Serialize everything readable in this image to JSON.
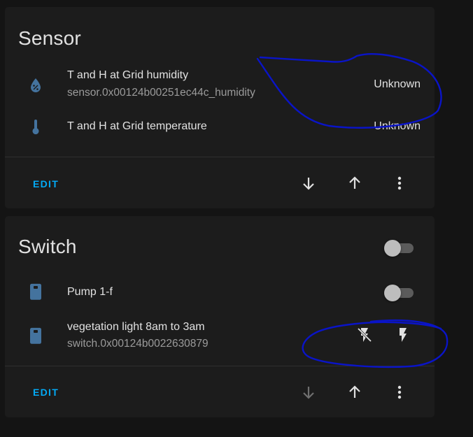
{
  "colors": {
    "background": "#141414",
    "card": "#1c1c1c",
    "accent": "#03a9f4",
    "icon": "#44739e",
    "annotation": "#0a14c8"
  },
  "sensor_card": {
    "title": "Sensor",
    "rows": [
      {
        "icon": "water-percent-icon",
        "name": "T and H at Grid humidity",
        "entity_id": "sensor.0x00124b00251ec44c_humidity",
        "state": "Unknown"
      },
      {
        "icon": "thermometer-icon",
        "name": "T and H at Grid temperature",
        "state": "Unknown"
      }
    ],
    "edit_label": "EDIT",
    "actions": [
      "arrow-down-icon",
      "arrow-up-icon",
      "dots-vertical-icon"
    ]
  },
  "switch_card": {
    "title": "Switch",
    "header_toggle_on": false,
    "rows": [
      {
        "icon": "smart-plug-icon",
        "name": "Pump 1-f",
        "toggle_on": false
      },
      {
        "icon": "smart-plug-icon",
        "name": "vegetation light 8am to 3am",
        "entity_id": "switch.0x00124b0022630879",
        "buttons": [
          "flash-off-icon",
          "flash-icon"
        ]
      }
    ],
    "edit_label": "EDIT",
    "actions": [
      "arrow-down-icon",
      "arrow-up-icon",
      "dots-vertical-icon"
    ],
    "move_down_disabled": true
  }
}
